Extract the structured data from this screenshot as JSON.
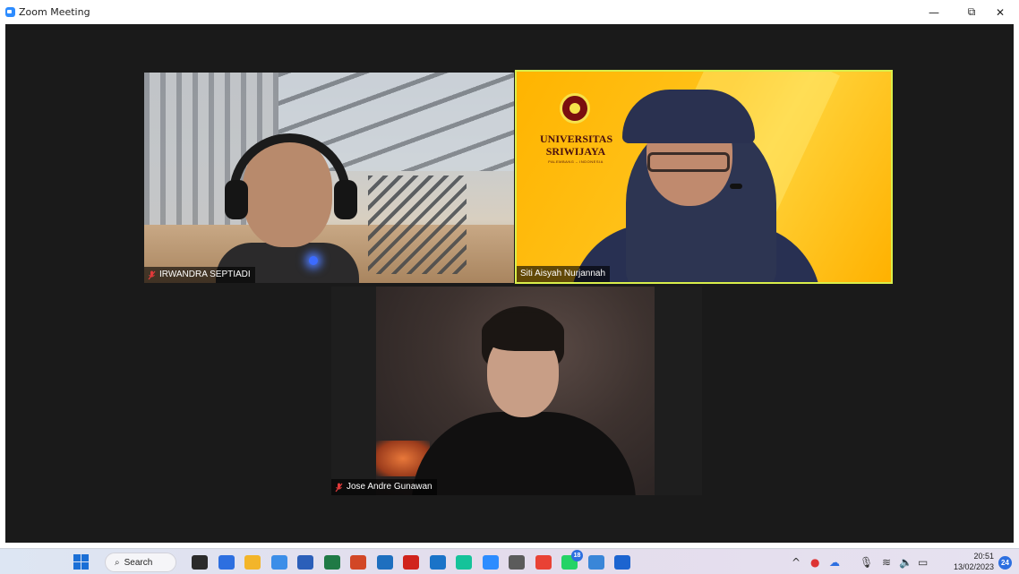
{
  "window": {
    "title": "Zoom Meeting",
    "controls": {
      "minimize": "—",
      "maximize": "⧉",
      "close": "✕"
    }
  },
  "participants": [
    {
      "name": "IRWANDRA SEPTIADI",
      "muted": true,
      "active_speaker": false
    },
    {
      "name": "Siti Aisyah Nurjannah",
      "muted": false,
      "active_speaker": true
    },
    {
      "name": "Jose Andre Gunawan",
      "muted": true,
      "active_speaker": false
    }
  ],
  "virtual_background": {
    "university_name_line1": "UNIVERSITAS",
    "university_name_line2": "SRIWIJAYA",
    "university_location": "PALEMBANG – INDONESIA"
  },
  "taskbar": {
    "search_label": "Search",
    "apps": [
      {
        "icon": "task-view-icon",
        "color": "#2b2b2b"
      },
      {
        "icon": "zoom-chat-icon",
        "color": "#2d6fe0"
      },
      {
        "icon": "file-explorer-icon",
        "color": "#f3b52a"
      },
      {
        "icon": "notepad-icon",
        "color": "#3c8ee8"
      },
      {
        "icon": "word-icon",
        "color": "#2b5fb9"
      },
      {
        "icon": "excel-icon",
        "color": "#1f7a45"
      },
      {
        "icon": "powerpoint-icon",
        "color": "#d24726"
      },
      {
        "icon": "photos-icon",
        "color": "#1e6fbf"
      },
      {
        "icon": "acrobat-icon",
        "color": "#d0231c"
      },
      {
        "icon": "media-icon",
        "color": "#1a73c8"
      },
      {
        "icon": "grammarly-icon",
        "color": "#15c39a"
      },
      {
        "icon": "zoom-icon",
        "color": "#2d8cff"
      },
      {
        "icon": "pen-tool-icon",
        "color": "#5b5b5b"
      },
      {
        "icon": "chrome-icon",
        "color": "#e94235"
      },
      {
        "icon": "whatsapp-icon",
        "color": "#25d366",
        "badge": "18"
      },
      {
        "icon": "snipping-icon",
        "color": "#3a86d8"
      },
      {
        "icon": "zoom-active-icon",
        "color": "#1c64d0"
      }
    ],
    "tray_icons": [
      "chevron-up-icon",
      "teams-icon",
      "onedrive-icon",
      "microphone-icon",
      "wifi-icon",
      "speaker-icon",
      "battery-icon"
    ],
    "time": "20:51",
    "date": "13/02/2023",
    "notification_count": "24"
  }
}
